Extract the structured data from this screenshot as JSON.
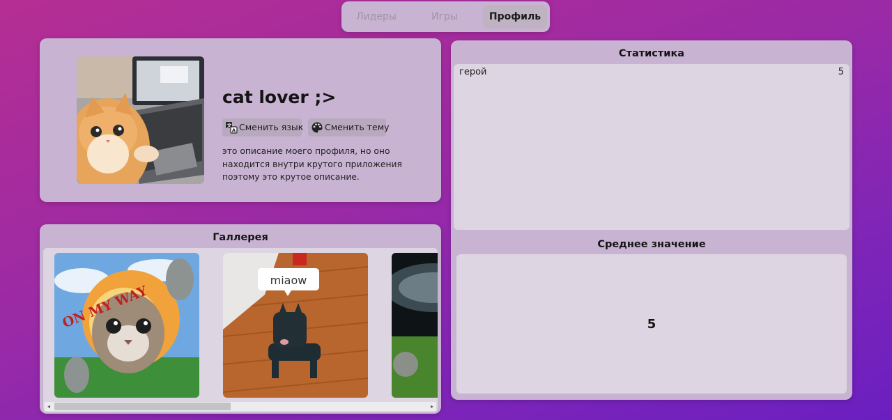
{
  "nav": {
    "tabs": [
      {
        "label": "Лидеры",
        "active": false
      },
      {
        "label": "Игры",
        "active": false
      },
      {
        "label": "Профиль",
        "active": true
      }
    ]
  },
  "profile": {
    "username": "cat lover ;>",
    "change_language_label": "Сменить язык",
    "change_theme_label": "Сменить тему",
    "description": "это описание моего профиля, но оно находится внутри крутого приложения поэтому это крутое описание."
  },
  "gallery": {
    "title": "Галлерея",
    "images": [
      {
        "text": "ON MY WAY"
      },
      {
        "text": "miaow"
      },
      {
        "text": ""
      }
    ]
  },
  "stats": {
    "title": "Статистика",
    "rows": [
      {
        "name": "герой",
        "value": "5"
      }
    ],
    "average_title": "Среднее значение",
    "average_value": "5"
  },
  "icons": {
    "language": "translate-icon",
    "theme": "palette-icon",
    "scroll_left": "chevron-left-icon",
    "scroll_right": "chevron-right-icon"
  }
}
